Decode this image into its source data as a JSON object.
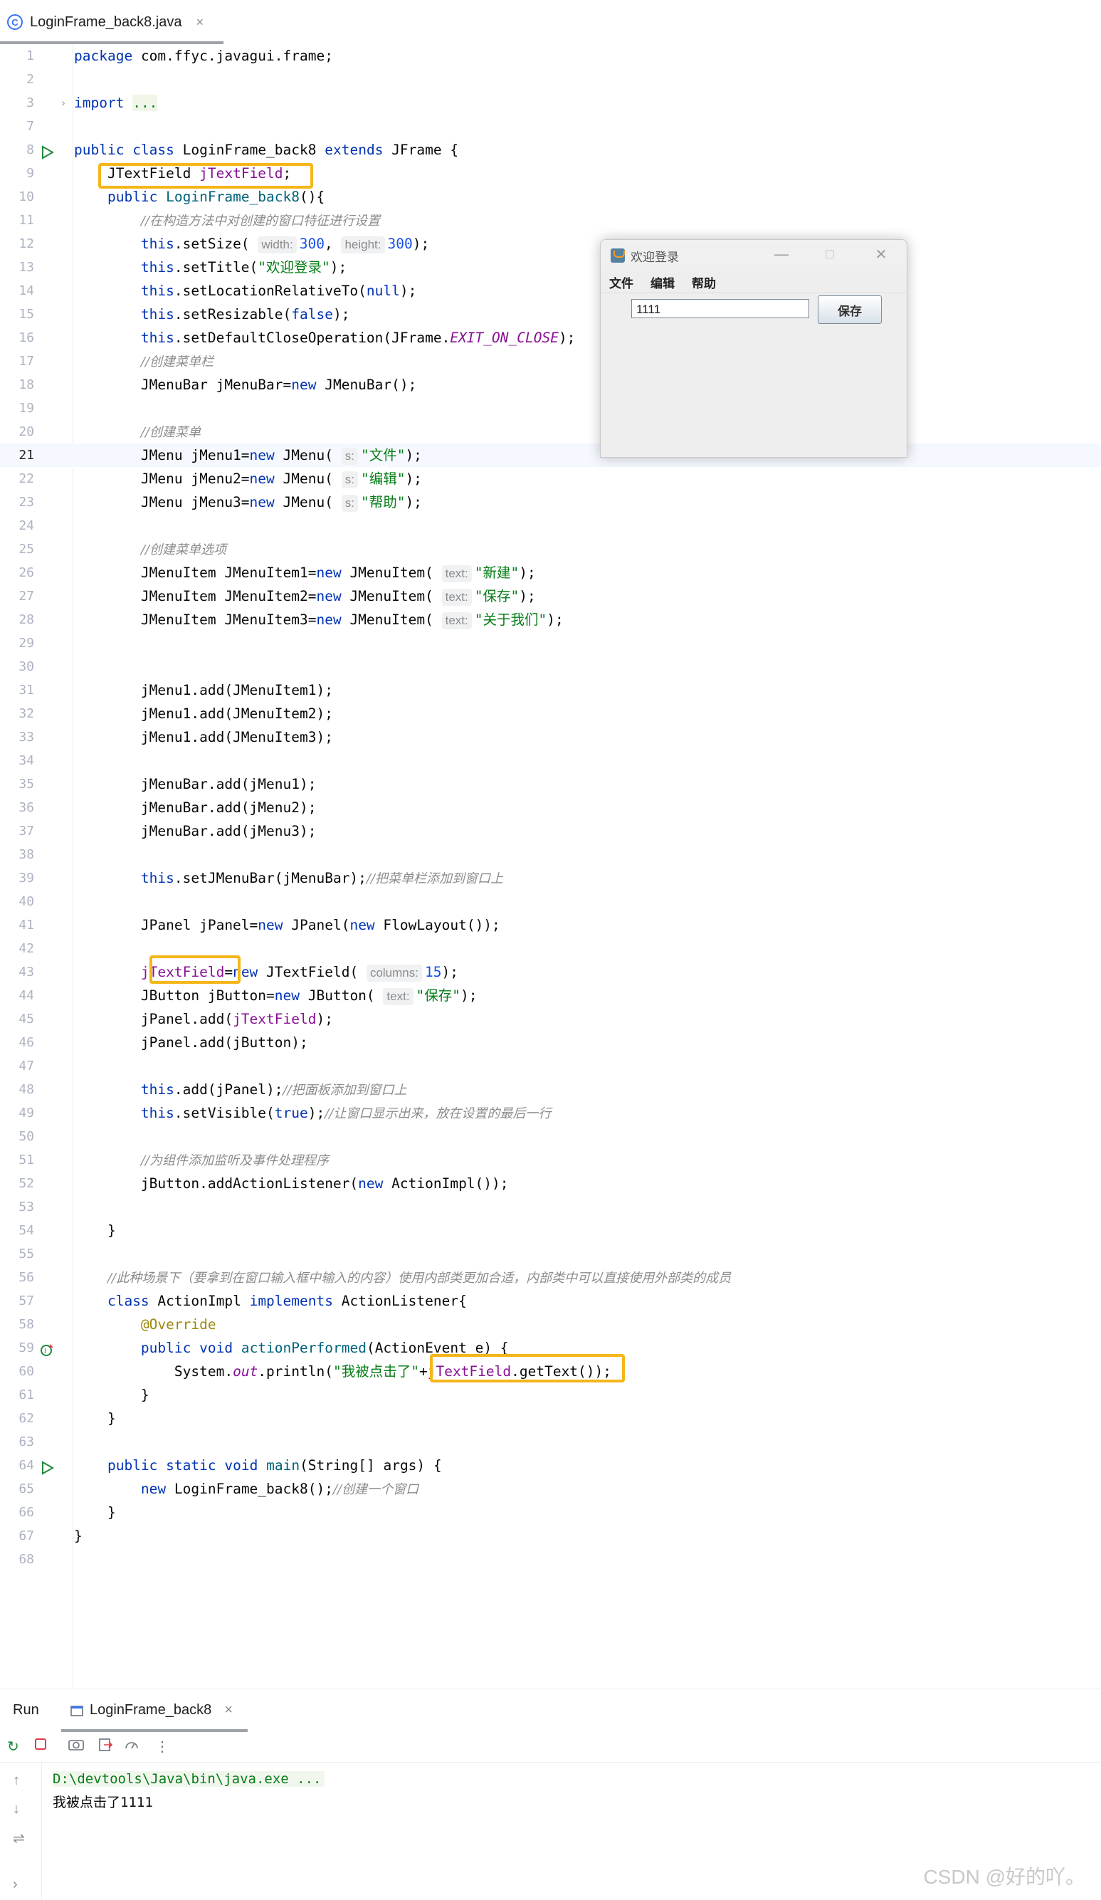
{
  "tab": {
    "filename": "LoginFrame_back8.java"
  },
  "lines": [
    "1",
    "2",
    "3",
    "7",
    "8",
    "9",
    "10",
    "11",
    "12",
    "13",
    "14",
    "15",
    "16",
    "17",
    "18",
    "19",
    "20",
    "21",
    "22",
    "23",
    "24",
    "25",
    "26",
    "27",
    "28",
    "29",
    "30",
    "31",
    "32",
    "33",
    "34",
    "35",
    "36",
    "37",
    "38",
    "39",
    "40",
    "41",
    "42",
    "43",
    "44",
    "45",
    "46",
    "47",
    "48",
    "49",
    "50",
    "51",
    "52",
    "53",
    "54",
    "55",
    "56",
    "57",
    "58",
    "59",
    "60",
    "61",
    "62",
    "63",
    "64",
    "65",
    "66",
    "67",
    "68"
  ],
  "code": {
    "package_stmt": "com.ffyc.javagui.frame;",
    "kw_package": "package",
    "kw_import": "import",
    "import_fold": "...",
    "kw_public": "public",
    "kw_class": "class",
    "class_name": "LoginFrame_back8",
    "kw_extends": "extends",
    "superclass": "JFrame {",
    "field_type": "JTextField",
    "field_name": "jTextField",
    "ctor": "LoginFrame_back8",
    "ctor_open": "(){",
    "c_window": "//在构造方法中对创建的窗口特征进行设置",
    "kw_this": "this",
    "setSize": ".setSize(",
    "hint_width": "width:",
    "v300": "300",
    "hint_height": "height:",
    "setTitle": ".setTitle(",
    "title_str": "\"欢迎登录\"",
    "setLoc": ".setLocationRelativeTo(",
    "kw_null": "null",
    "setResizable": ".setResizable(",
    "kw_false": "false",
    "setDefault": ".setDefaultCloseOperation(JFrame.",
    "exit_const": "EXIT_ON_CLOSE",
    "c_menubar": "//创建菜单栏",
    "menubar_decl": "JMenuBar jMenuBar=",
    "kw_new": "new",
    "menubar_ctor": " JMenuBar();",
    "c_menu": "//创建菜单",
    "menu1_decl": "JMenu jMenu1=",
    "menu2_decl": "JMenu jMenu2=",
    "menu3_decl": "JMenu jMenu3=",
    "jmenu_ctor": " JMenu(",
    "hint_s": "s:",
    "str_file": "\"文件\"",
    "str_edit": "\"编辑\"",
    "str_help": "\"帮助\"",
    "c_items": "//创建菜单选项",
    "item1_decl": "JMenuItem JMenuItem1=",
    "item2_decl": "JMenuItem JMenuItem2=",
    "item3_decl": "JMenuItem JMenuItem3=",
    "jmenuitem_ctor": " JMenuItem(",
    "hint_text": "text:",
    "str_new": "\"新建\"",
    "str_save": "\"保存\"",
    "str_about": "\"关于我们\"",
    "add_item1": "jMenu1.add(JMenuItem1);",
    "add_item2": "jMenu1.add(JMenuItem2);",
    "add_item3": "jMenu1.add(JMenuItem3);",
    "bar_add1": "jMenuBar.add(jMenu1);",
    "bar_add2": "jMenuBar.add(jMenu2);",
    "bar_add3": "jMenuBar.add(jMenu3);",
    "setJMenuBar": ".setJMenuBar(jMenuBar);",
    "c_addbar": "//把菜单栏添加到窗口上",
    "panel_decl": "JPanel jPanel=",
    "panel_ctor": " JPanel(",
    "flow": " FlowLayout());",
    "tf_assign": "=",
    "tf_ctor": " JTextField(",
    "hint_columns": "columns:",
    "v15": "15",
    "button_decl": "JButton jButton=",
    "button_ctor": " JButton(",
    "panel_add_tf": "jPanel.add(",
    "close_paren_semi": ");",
    "panel_add_btn": "jPanel.add(jButton);",
    "add_panel": ".add(jPanel);",
    "c_addpanel": "//把面板添加到窗口上",
    "setVisible": ".setVisible(",
    "kw_true": "true",
    "c_visible": "//让窗口显示出来，放在设置的最后一行",
    "c_listener": "//为组件添加监听及事件处理程序",
    "add_listener": "jButton.addActionListener(",
    "impl_ctor": " ActionImpl());",
    "brace_close": "}",
    "c_inner": "//此种场景下（要拿到在窗口输入框中输入的内容）使用内部类更加合适，内部类中可以直接使用外部类的成员",
    "impl_name": "ActionImpl",
    "kw_implements": "implements",
    "iface": "ActionListener{",
    "anno": "@Override",
    "kw_void": "void",
    "action_method": "actionPerformed",
    "action_params": "(ActionEvent e) {",
    "sysout_a": "System.",
    "sysout_out": "out",
    "println": ".println(",
    "str_clicked": "\"我被点击了\"",
    "plus": "+",
    "getText": ".getText());",
    "kw_static": "static",
    "main_method": "main",
    "main_params": "(String[] args) {",
    "new_frame": " LoginFrame_back8();",
    "c_create": "//创建一个窗口",
    "semi": ";",
    "close_paren_brace": ");"
  },
  "swing_window": {
    "title": "欢迎登录",
    "minimize": "—",
    "maximize": "☐",
    "close": "✕",
    "menus": [
      "文件",
      "编辑",
      "帮助"
    ],
    "text_value": "1111",
    "button_label": "保存"
  },
  "run_panel": {
    "title": "Run",
    "tab_label": "LoginFrame_back8",
    "command": "D:\\devtools\\Java\\bin\\java.exe ...",
    "output": "我被点击了1111"
  },
  "watermark": "CSDN @好的吖。"
}
